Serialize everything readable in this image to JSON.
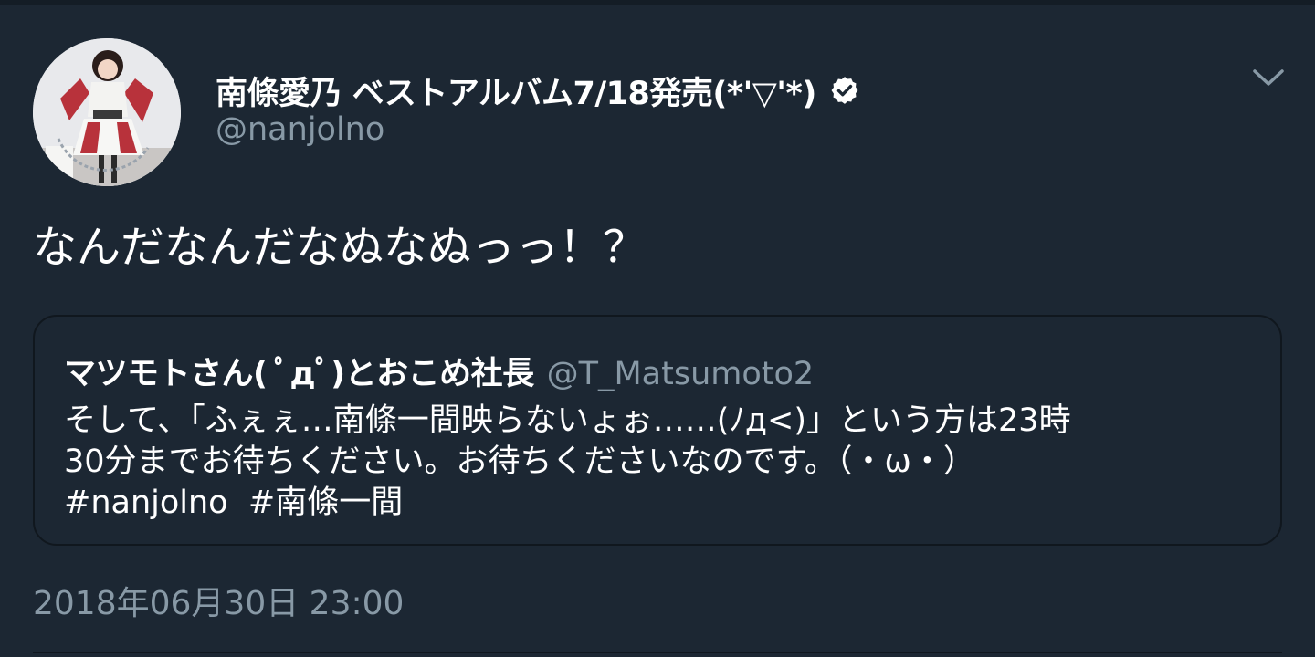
{
  "tweet": {
    "author": {
      "display_name": "南條愛乃 ベストアルバム7/18発売(*'▽'*)",
      "handle": "@nanjolno",
      "verified": true,
      "avatar_icon": "profile-photo"
    },
    "menu_icon": "chevron-down-icon",
    "text": "なんだなんだなぬなぬっっ！？",
    "quoted": {
      "display_name": "マツモトさん( ﾟдﾟ)とおこめ社長",
      "handle": "@T_Matsumoto2",
      "lines": [
        "そして、「ふぇぇ…南條一間映らないょぉ……(ﾉд<)」という方は23時",
        "30分までお待ちください。お待ちくださいなのです。（・ω・）"
      ],
      "hashtags": [
        "#nanjolno",
        "#南條一間"
      ]
    },
    "timestamp": "2018年06月30日  23:00"
  },
  "colors": {
    "background": "#1c2733",
    "secondary_text": "#8899a6",
    "border": "#10171e"
  }
}
